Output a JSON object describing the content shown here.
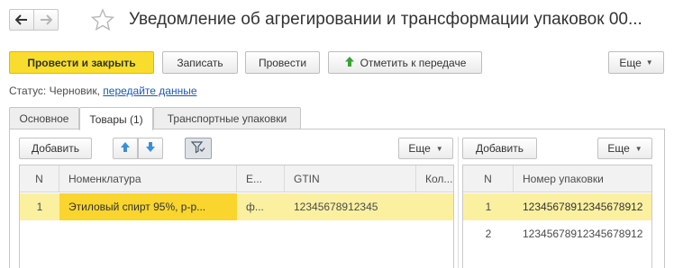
{
  "window": {
    "title": "Уведомление об агрегировании и трансформации упаковок 00..."
  },
  "nav": {
    "back_icon": "arrow-left-icon",
    "forward_icon": "arrow-right-icon",
    "favorite_icon": "star-icon"
  },
  "toolbar": {
    "post_close": "Провести и закрыть",
    "save": "Записать",
    "post": "Провести",
    "mark_transfer": "Отметить к передаче",
    "more": "Еще",
    "mark_icon": "green-arrow-up-icon"
  },
  "status": {
    "label": "Статус:",
    "value": "Черновик,",
    "link": "передайте данные"
  },
  "tabs": [
    {
      "label": "Основное",
      "active": false
    },
    {
      "label": "Товары (1)",
      "active": true
    },
    {
      "label": "Транспортные упаковки",
      "active": false
    }
  ],
  "goods_panel": {
    "add": "Добавить",
    "more": "Еще",
    "up_icon": "move-up-icon",
    "down_icon": "move-down-icon",
    "filter_icon": "filter-icon",
    "columns": [
      "N",
      "Номенклатура",
      "Е...",
      "GTIN",
      "Кол..."
    ],
    "rows": [
      {
        "n": "1",
        "item": "Этиловый спирт 95%, р-р...",
        "unit": "ф...",
        "gtin": "12345678912345",
        "qty": ""
      }
    ]
  },
  "packages_panel": {
    "add": "Добавить",
    "more": "Еще",
    "columns": [
      "N",
      "Номер упаковки"
    ],
    "rows": [
      {
        "n": "1",
        "number": "12345678912345678912"
      },
      {
        "n": "2",
        "number": "12345678912345678912"
      }
    ]
  },
  "colors": {
    "accent_yellow": "#f9dd2c",
    "selected_row": "#fbf0a0",
    "link_blue": "#1a5ab4",
    "arrow_blue": "#3a8fd9",
    "mark_green": "#3aa335"
  }
}
